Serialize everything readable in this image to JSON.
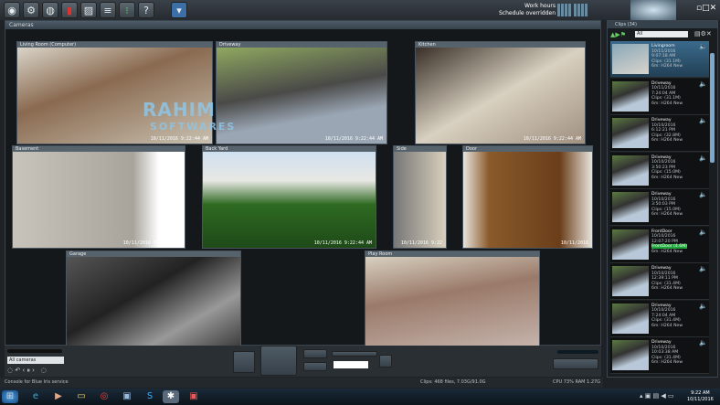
{
  "toolbar": {
    "icons": [
      "camera-icon",
      "gear-icon",
      "globe-icon",
      "chart-icon",
      "image-icon",
      "list-icon",
      "traffic-light-icon",
      "help-icon",
      "shield-icon"
    ],
    "help_label": "?"
  },
  "schedule": {
    "line1": "Work hours",
    "line2": "Schedule overridden"
  },
  "cameras_panel": {
    "title": "Cameras"
  },
  "watermark": {
    "line1": "RAHIM",
    "line2": "SOFTWARES"
  },
  "cameras": [
    {
      "name": "Living Room (Computer)",
      "timestamp": "10/11/2016 9:22:44 AM"
    },
    {
      "name": "Driveway",
      "timestamp": "10/11/2016 9:22:44 AM"
    },
    {
      "name": "Kitchen",
      "timestamp": "10/11/2016 9:22:44 AM"
    },
    {
      "name": "Basement",
      "timestamp": "10/11/2016 9:22:44 AM"
    },
    {
      "name": "Back Yard",
      "timestamp": "10/11/2016 9:22:44 AM"
    },
    {
      "name": "Side",
      "timestamp": "10/11/2016 9:22"
    },
    {
      "name": "Door",
      "timestamp": "10/11/2016"
    },
    {
      "name": "Garage",
      "timestamp": ""
    },
    {
      "name": "Play Room",
      "timestamp": ""
    }
  ],
  "clips_panel": {
    "title": "Clips",
    "count": "(34)",
    "filter": "All"
  },
  "clips": [
    {
      "camera": "Livingroom",
      "date": "10/11/2016",
      "time": "9:07:18 AM",
      "info": "Clips: (31.1M)",
      "codec": "6m: H264 New"
    },
    {
      "camera": "Driveway",
      "date": "10/11/2016",
      "time": "7:24:04 AM",
      "info": "Clips: (31.1M)",
      "codec": "6m: H264 New"
    },
    {
      "camera": "Driveway",
      "date": "10/10/2016",
      "time": "6:12:21 PM",
      "info": "Clips: (32.8M)",
      "codec": "6m: H264 New"
    },
    {
      "camera": "Driveway",
      "date": "10/10/2016",
      "time": "3:50:23 PM",
      "info": "Clips: (15.0M)",
      "codec": "6m: H264 New"
    },
    {
      "camera": "Driveway",
      "date": "10/10/2016",
      "time": "3:50:03 PM",
      "info": "Clips: (15.0M)",
      "codec": "6m: H264 New"
    },
    {
      "camera": "FrontDoor",
      "date": "10/10/2016",
      "time": "12:07:20 PM",
      "info": "FrontDoor (4.6M)",
      "codec": "6m: H264 New",
      "highlight": true
    },
    {
      "camera": "Driveway",
      "date": "10/10/2016",
      "time": "12:39:11 PM",
      "info": "Clips: (31.4M)",
      "codec": "6m: H264 New"
    },
    {
      "camera": "Driveway",
      "date": "10/10/2016",
      "time": "7:24:04 AM",
      "info": "Clips: (31.4M)",
      "codec": "6m: H264 New"
    },
    {
      "camera": "Driveway",
      "date": "10/10/2016",
      "time": "10:03:38 AM",
      "info": "Clips: (31.4M)",
      "codec": "6m: H264 New"
    }
  ],
  "controls": {
    "camera_select": "All cameras"
  },
  "status": {
    "left": "Console for Blue Iris service",
    "center": "Clips: 468 files, 7.03G/91.0G",
    "right": "CPU 73% RAM 1.27G"
  },
  "taskbar": {
    "time": "9:22 AM",
    "date": "10/11/2016"
  },
  "colors": {
    "highlight": "#1fa83a",
    "accent": "#4d8fbf"
  }
}
